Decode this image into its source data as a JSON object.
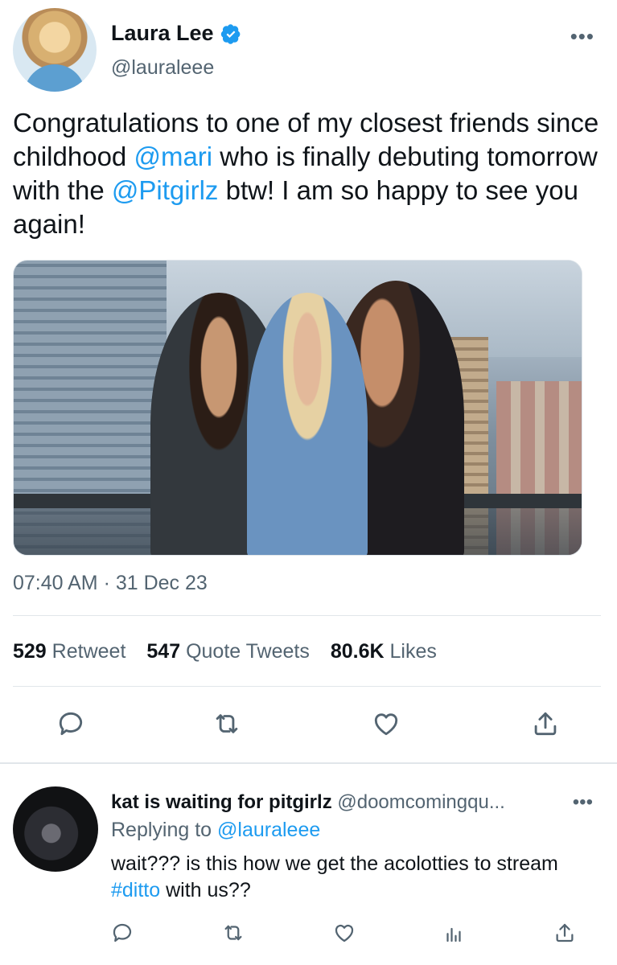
{
  "tweet": {
    "author": {
      "display_name": "Laura Lee",
      "handle": "@lauraleee",
      "verified": true
    },
    "text_parts": {
      "p1": "Congratulations to one of my closest friends since childhood ",
      "m1": "@mari",
      "p2": " who is finally debuting tomorrow with the ",
      "m2": "@Pitgirlz",
      "p3": " btw! I am so happy to see you again!"
    },
    "timestamp": "07:40 AM · 31 Dec 23",
    "stats": {
      "retweets_count": "529",
      "retweets_label": "Retweet",
      "quotes_count": "547",
      "quotes_label": "Quote Tweets",
      "likes_count": "80.6K",
      "likes_label": "Likes"
    },
    "icons": [
      "more-icon",
      "verified-icon",
      "reply-icon",
      "retweet-icon",
      "like-icon",
      "share-icon",
      "analytics-icon"
    ],
    "colors": {
      "accent": "#1d9bf0",
      "text": "#0f1419",
      "secondary": "#536471",
      "divider": "#e1e6ea"
    }
  },
  "reply": {
    "display_name": "kat is waiting for pitgirlz",
    "handle": "@doomcomingqu...",
    "replying_prefix": "Replying to ",
    "replying_to": "@lauraleee",
    "text_parts": {
      "p1": "wait??? is this how we get the acolotties to stream ",
      "hashtag": "#ditto",
      "p2": " with us??"
    }
  }
}
